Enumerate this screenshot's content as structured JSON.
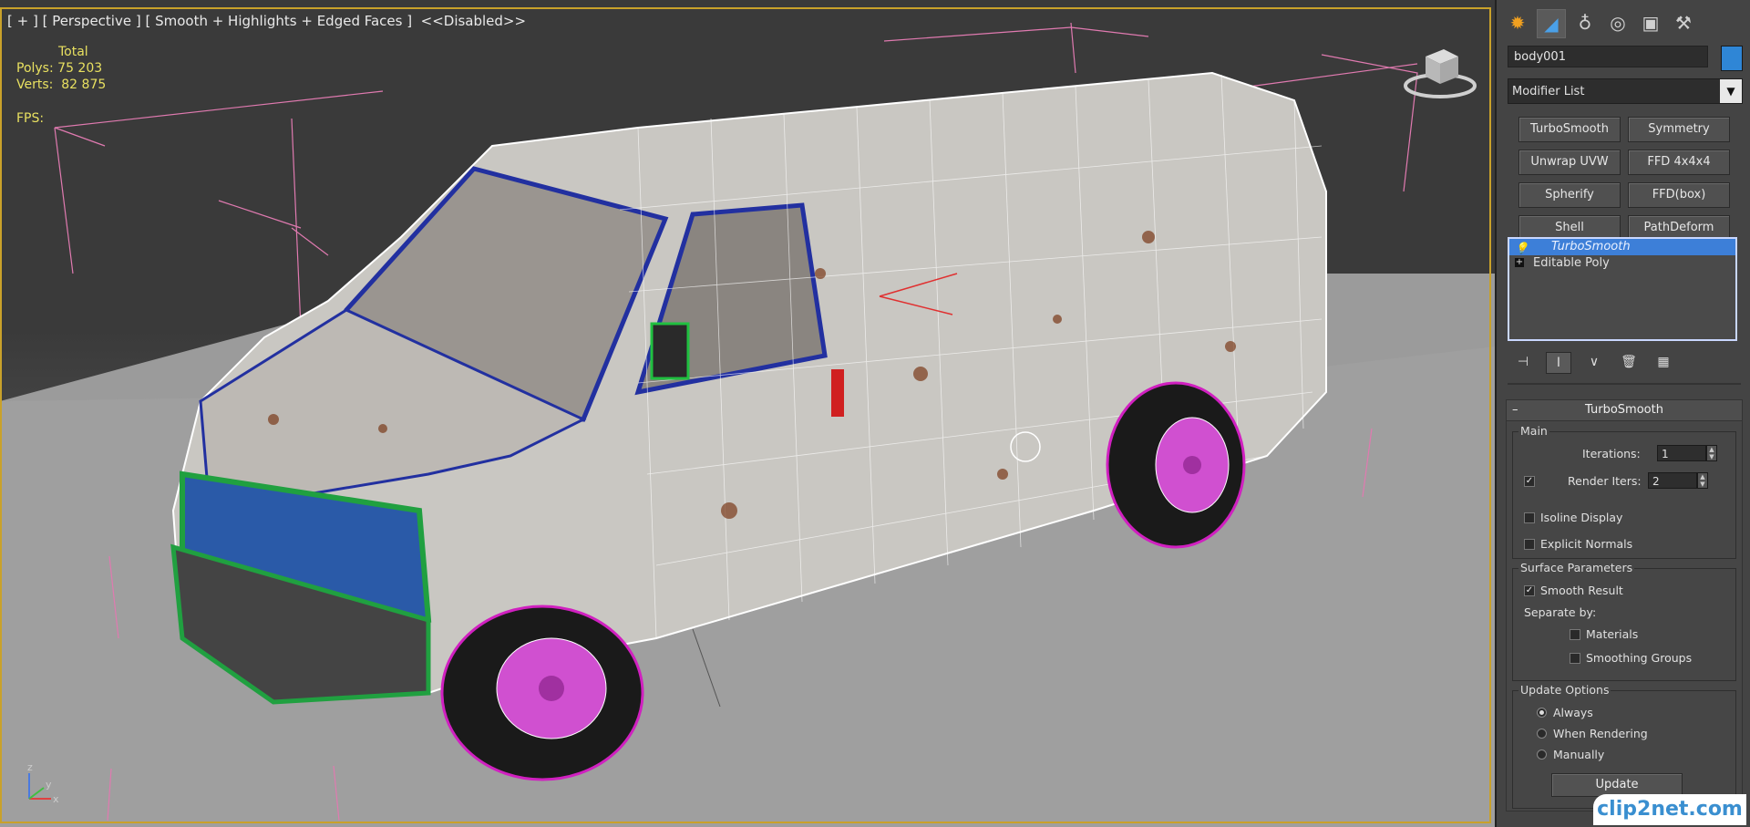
{
  "viewport": {
    "label": "[ + ] [ Perspective ] [ Smooth + Highlights + Edged Faces ]  <<Disabled>>",
    "stats": {
      "total_label": "Total",
      "polys_label": "Polys:",
      "polys_value": "75 203",
      "verts_label": "Verts:",
      "verts_value": "82 875"
    },
    "fps_label": "FPS:",
    "viewcube_icon": "viewcube-icon",
    "axis_labels": {
      "z": "z",
      "x": "x",
      "y": "y"
    }
  },
  "panel": {
    "tabs": [
      {
        "icon": "create-icon",
        "glyph": "✹"
      },
      {
        "icon": "modify-icon",
        "glyph": "◢"
      },
      {
        "icon": "hierarchy-icon",
        "glyph": "♁"
      },
      {
        "icon": "motion-icon",
        "glyph": "◎"
      },
      {
        "icon": "display-icon",
        "glyph": "▣"
      },
      {
        "icon": "utilities-icon",
        "glyph": "⚒"
      }
    ],
    "object_name": "body001",
    "object_color": "#2f86d6",
    "modifier_list_label": "Modifier List",
    "modifier_buttons": [
      "TurboSmooth",
      "Symmetry",
      "Unwrap UVW",
      "FFD 4x4x4",
      "Spherify",
      "FFD(box)",
      "Shell",
      "PathDeform"
    ],
    "stack": [
      {
        "label": "TurboSmooth",
        "selected": true
      },
      {
        "label": "Editable Poly",
        "selected": false
      }
    ],
    "turbosmooth": {
      "title": "TurboSmooth",
      "main_group": "Main",
      "iterations_label": "Iterations:",
      "iterations_value": "1",
      "render_iters_label": "Render Iters:",
      "render_iters_value": "2",
      "render_iters_checked": true,
      "isoline_label": "Isoline Display",
      "explicit_normals_label": "Explicit Normals",
      "surface_group": "Surface Parameters",
      "smooth_result_label": "Smooth Result",
      "separate_by_label": "Separate by:",
      "materials_label": "Materials",
      "smoothing_groups_label": "Smoothing Groups",
      "update_group": "Update Options",
      "always_label": "Always",
      "when_rendering_label": "When Rendering",
      "manually_label": "Manually",
      "update_button": "Update"
    },
    "watermark": "clip2net.com"
  }
}
